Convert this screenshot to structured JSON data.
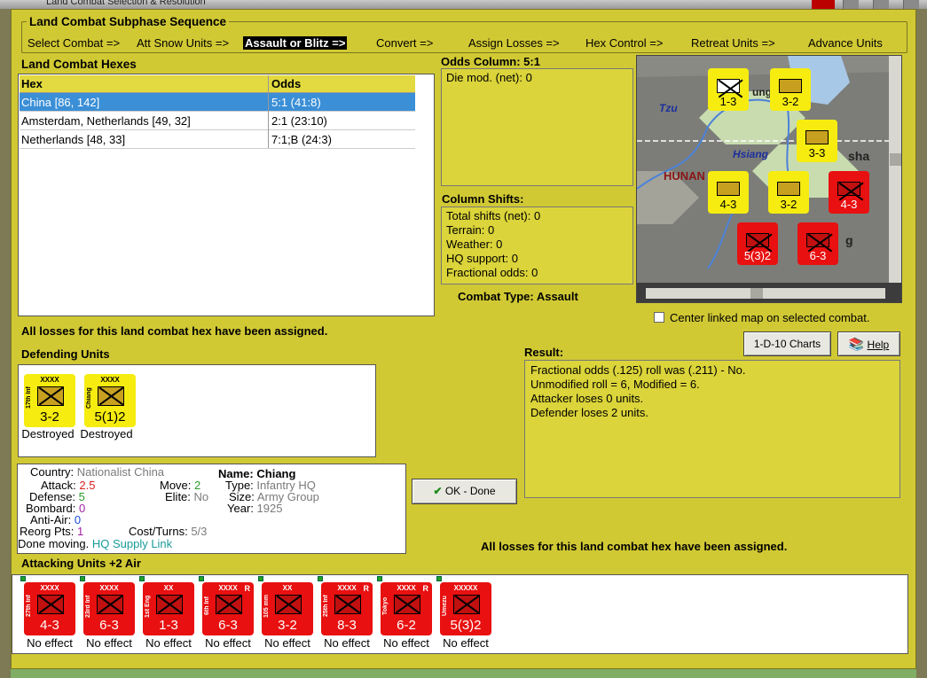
{
  "window": {
    "title": "Land Combat Selection & Resolution"
  },
  "sequence": {
    "title": "Land Combat Subphase Sequence",
    "steps": [
      "Select Combat =>",
      "Att Snow Units =>",
      "Assault or Blitz =>",
      "Convert =>",
      "Assign Losses =>",
      "Hex Control =>",
      "Retreat Units =>",
      "Advance Units"
    ],
    "active_step": "Assault or Blitz =>"
  },
  "hexes": {
    "title": "Land Combat Hexes",
    "headers": [
      "Hex",
      "Odds"
    ],
    "rows": [
      {
        "hex": "China [86, 142]",
        "odds": "5:1 (41:8)"
      },
      {
        "hex": "Amsterdam, Netherlands [49, 32]",
        "odds": "2:1 (23:10)"
      },
      {
        "hex": "Netherlands [48, 33]",
        "odds": "7:1;B (24:3)"
      }
    ]
  },
  "odds_column": {
    "title": "Odds Column: 5:1",
    "die_mod": "Die mod. (net): 0"
  },
  "column_shifts": {
    "title": "Column Shifts:",
    "lines": [
      "Total shifts (net): 0",
      "Terrain: 0",
      "Weather: 0",
      "HQ support: 0",
      "Fractional odds: 0"
    ]
  },
  "combat_type": "Combat Type:  Assault",
  "map": {
    "labels": {
      "tzu": "Tzu",
      "hsiang": "Hsiang",
      "hunan": "HUNAN",
      "sha": "sha",
      "g": "g",
      "ung": "ung"
    }
  },
  "center_checkbox_label": "Center linked map on selected combat.",
  "losses_message": "All losses for this land combat hex have been assigned.",
  "buttons": {
    "charts": "1-D-10 Charts",
    "help": "Help",
    "ok": "OK - Done"
  },
  "defending": {
    "title": "Defending Units",
    "units": [
      {
        "name": "17th Inf",
        "size": "XXXX",
        "values": "3-2",
        "status": "Destroyed"
      },
      {
        "name": "Chiang",
        "size": "XXXX",
        "values": "5(1)2",
        "status": "Destroyed"
      }
    ]
  },
  "result": {
    "title": "Result:",
    "lines": [
      "Fractional odds (.125) roll was (.211)  - No.",
      "Unmodified roll = 6, Modified = 6.",
      "Attacker loses 0 units.",
      "Defender loses 2 units."
    ]
  },
  "unit_info": {
    "country_label": "Country:",
    "country": "Nationalist China",
    "attack_label": "Attack:",
    "attack": "2.5",
    "defense_label": "Defense:",
    "defense": "5",
    "bombard_label": "Bombard:",
    "bombard": "0",
    "antiair_label": "Anti-Air:",
    "antiair": "0",
    "reorg_label": "Reorg Pts:",
    "reorg": "1",
    "move_label": "Move:",
    "move": "2",
    "elite_label": "Elite:",
    "elite": "No",
    "cost_label": "Cost/Turns:",
    "cost": "5/3",
    "name_label": "Name:",
    "name": "Chiang",
    "type_label": "Type:",
    "type": "Infantry HQ",
    "size_label": "Size:",
    "size": "Army Group",
    "year_label": "Year:",
    "year": "1925",
    "done_moving": "Done moving.",
    "supply": "HQ Supply Link"
  },
  "attacking": {
    "title": "Attacking Units +2 Air",
    "units": [
      {
        "name": "27th Inf",
        "size": "XXXX",
        "values": "4-3",
        "status": "No effect",
        "r": ""
      },
      {
        "name": "23rd Inf",
        "size": "XXXX",
        "values": "6-3",
        "status": "No effect",
        "r": ""
      },
      {
        "name": "1st Eng",
        "size": "XX",
        "values": "1-3",
        "status": "No effect",
        "r": ""
      },
      {
        "name": "6th Inf",
        "size": "XXXX",
        "values": "6-3",
        "status": "No effect",
        "r": "R"
      },
      {
        "name": "105 mm",
        "size": "XX",
        "values": "3-2",
        "status": "No effect",
        "r": ""
      },
      {
        "name": "25th Inf",
        "size": "XXXX",
        "values": "8-3",
        "status": "No effect",
        "r": "R"
      },
      {
        "name": "Tokyo",
        "size": "XXXX",
        "values": "6-2",
        "status": "No effect",
        "r": "R"
      },
      {
        "name": "Umezu",
        "size": "XXXXX",
        "values": "5(3)2",
        "status": "No effect",
        "r": ""
      }
    ]
  },
  "colors": {
    "panel": "#d1c934",
    "selected_row": "#3b8fd6",
    "japan_counter": "#e81010",
    "china_counter": "#f6ec10"
  }
}
